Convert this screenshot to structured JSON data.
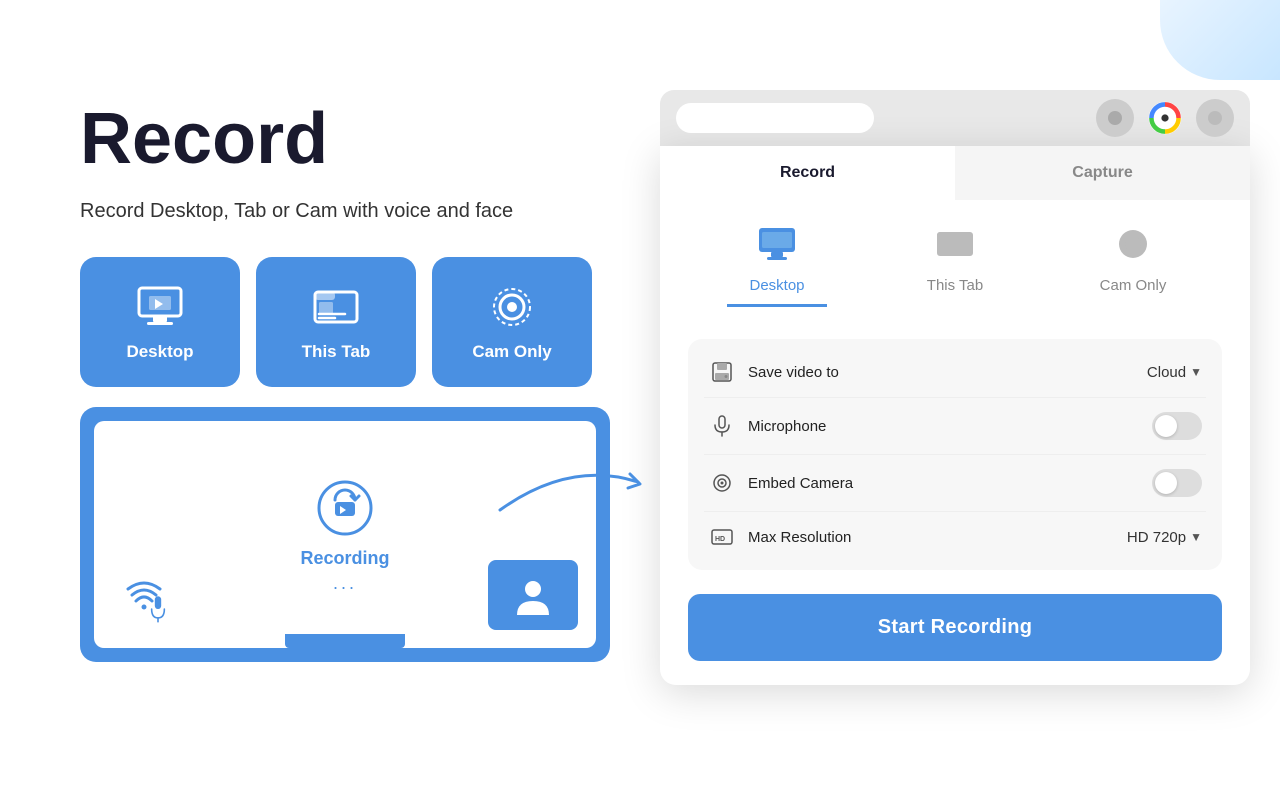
{
  "header": {
    "title": "Record",
    "subtitle": "Record Desktop, Tab or Cam with voice and face"
  },
  "mode_buttons": [
    {
      "id": "desktop",
      "label": "Desktop"
    },
    {
      "id": "this-tab",
      "label": "This Tab"
    },
    {
      "id": "cam-only",
      "label": "Cam Only"
    }
  ],
  "preview": {
    "recording_text": "Recording",
    "dots": "..."
  },
  "popup": {
    "tabs": [
      {
        "id": "record",
        "label": "Record",
        "active": true
      },
      {
        "id": "capture",
        "label": "Capture",
        "active": false
      }
    ],
    "mode_tabs": [
      {
        "id": "desktop",
        "label": "Desktop",
        "active": true
      },
      {
        "id": "this-tab",
        "label": "This Tab",
        "active": false
      },
      {
        "id": "cam-only",
        "label": "Cam Only",
        "active": false
      }
    ],
    "settings": [
      {
        "id": "save-video",
        "label": "Save video to",
        "value": "Cloud",
        "type": "dropdown",
        "icon": "save-icon"
      },
      {
        "id": "microphone",
        "label": "Microphone",
        "type": "toggle",
        "enabled": false,
        "icon": "mic-icon"
      },
      {
        "id": "embed-camera",
        "label": "Embed Camera",
        "type": "toggle",
        "enabled": false,
        "icon": "camera-icon"
      },
      {
        "id": "max-resolution",
        "label": "Max Resolution",
        "value": "HD 720p",
        "type": "dropdown",
        "icon": "hd-icon"
      }
    ],
    "start_button_label": "Start Recording"
  },
  "colors": {
    "blue": "#4A90E2",
    "dark": "#1a1a2e",
    "gray": "#888",
    "light_gray": "#f5f5f5"
  }
}
